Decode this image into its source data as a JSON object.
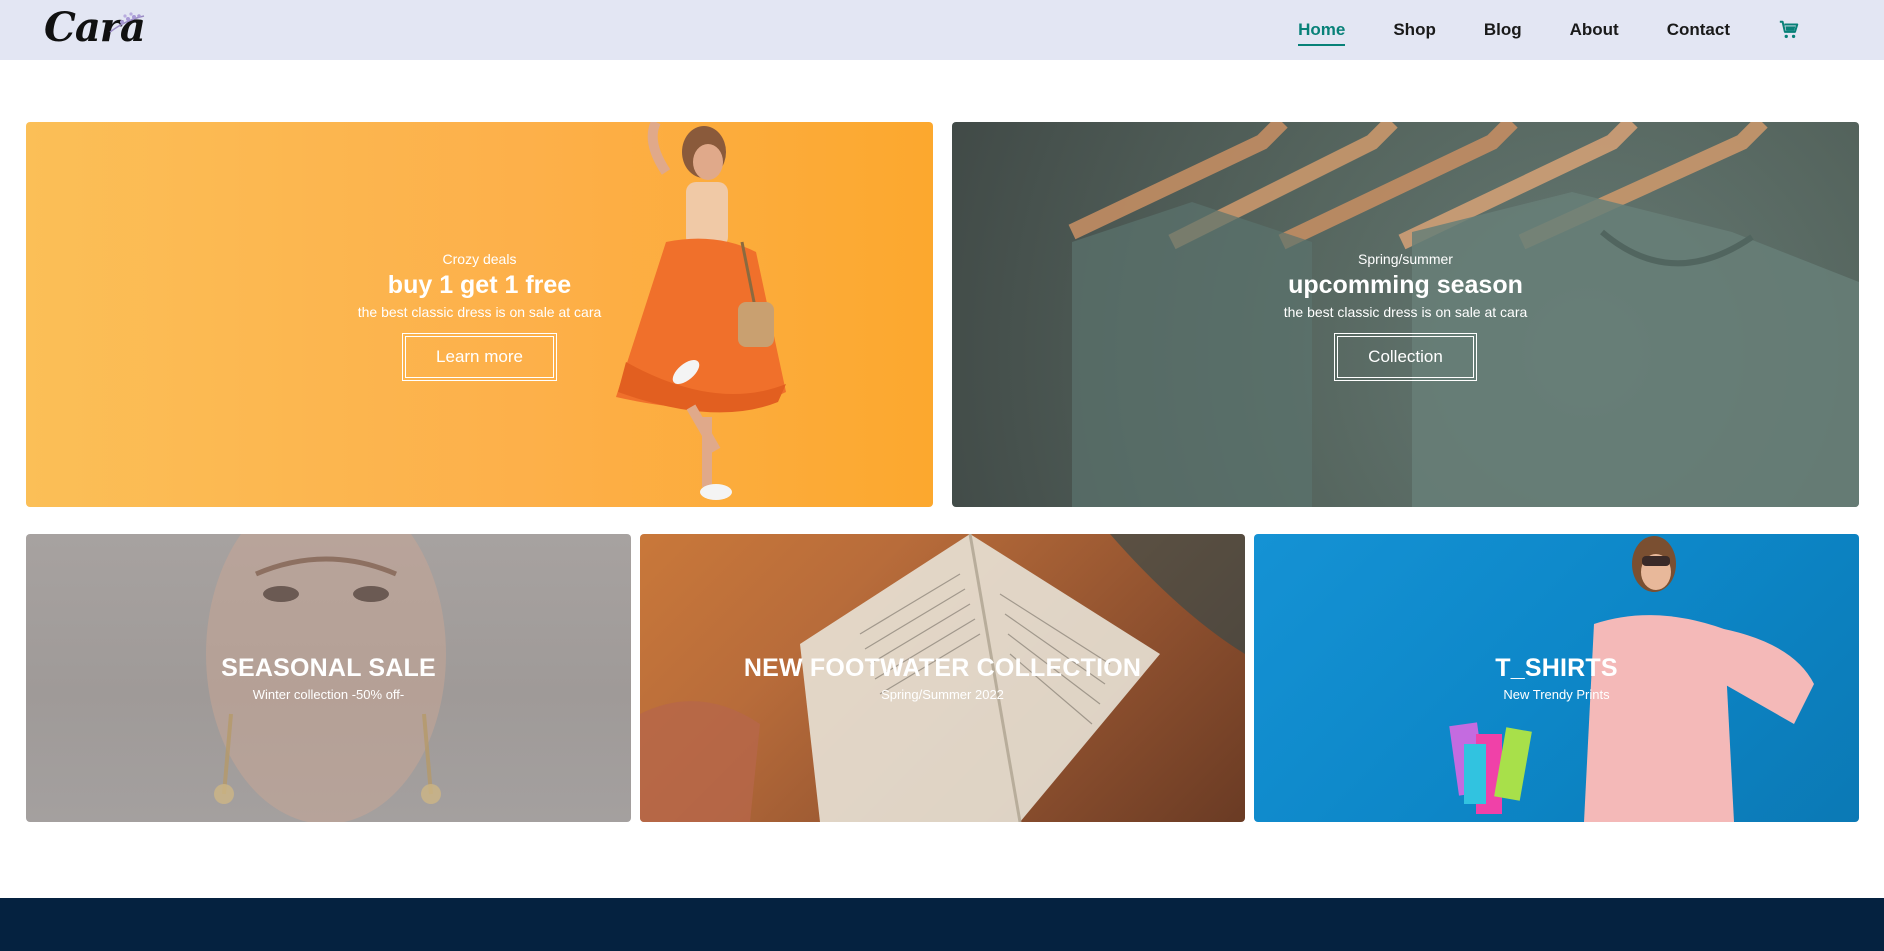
{
  "header": {
    "logo_text": "Cara",
    "nav": [
      {
        "label": "Home",
        "active": true
      },
      {
        "label": "Shop",
        "active": false
      },
      {
        "label": "Blog",
        "active": false
      },
      {
        "label": "About",
        "active": false
      },
      {
        "label": "Contact",
        "active": false
      }
    ],
    "cart_icon": "cart-icon"
  },
  "banners_top": [
    {
      "eyebrow": "Crozy deals",
      "title": "buy 1 get 1 free",
      "subtitle": "the best classic dress is on sale at cara",
      "button": "Learn more"
    },
    {
      "eyebrow": "Spring/summer",
      "title": "upcomming season",
      "subtitle": "the best classic dress is on sale at cara",
      "button": "Collection"
    }
  ],
  "banners_bottom": [
    {
      "title": "SEASONAL SALE",
      "subtitle": "Winter collection -50% off-"
    },
    {
      "title": "NEW FOOTWATER COLLECTION",
      "subtitle": "Spring/Summer 2022"
    },
    {
      "title": "T_SHIRTS",
      "subtitle": "New Trendy Prints"
    }
  ],
  "colors": {
    "accent": "#088178",
    "header_bg": "#e3e6f3",
    "footer_bg": "#052240"
  }
}
